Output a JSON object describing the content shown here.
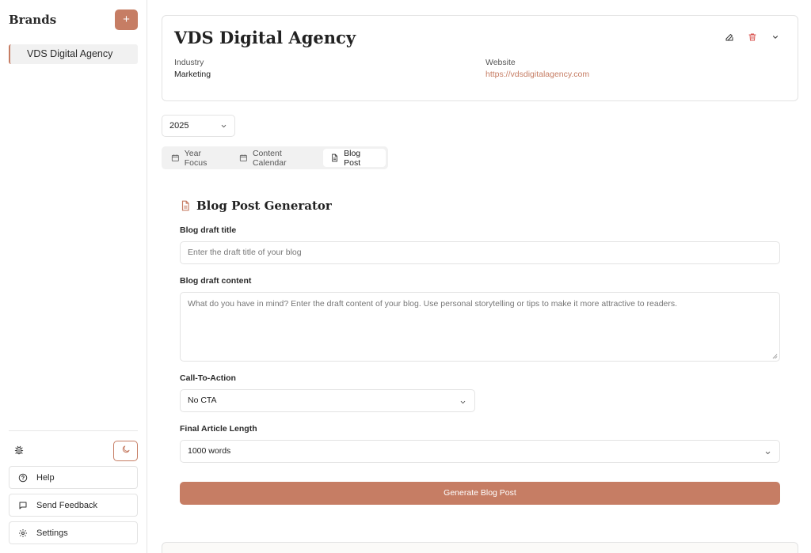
{
  "sidebar": {
    "title": "Brands",
    "add_label": "+",
    "brands": [
      "VDS Digital Agency"
    ],
    "help_label": "Help",
    "feedback_label": "Send Feedback",
    "settings_label": "Settings"
  },
  "brand": {
    "name": "VDS Digital Agency",
    "industry_label": "Industry",
    "industry": "Marketing",
    "website_label": "Website",
    "website": "https://vdsdigitalagency.com"
  },
  "year": "2025",
  "tabs": [
    {
      "label": "Year Focus",
      "active": false
    },
    {
      "label": "Content Calendar",
      "active": false
    },
    {
      "label": "Blog Post",
      "active": true
    }
  ],
  "generator": {
    "title": "Blog Post Generator",
    "draft_title_label": "Blog draft title",
    "draft_title_placeholder": "Enter the draft title of your blog",
    "draft_content_label": "Blog draft content",
    "draft_content_placeholder": "What do you have in mind? Enter the draft content of your blog. Use personal storytelling or tips to make it more attractive to readers.",
    "cta_label": "Call-To-Action",
    "cta_value": "No CTA",
    "length_label": "Final Article Length",
    "length_value": "1000 words",
    "button_label": "Generate Blog Post"
  },
  "colors": {
    "accent": "#c67d64",
    "border": "#e3e3e3",
    "tab_bg": "#f1f1f1"
  }
}
